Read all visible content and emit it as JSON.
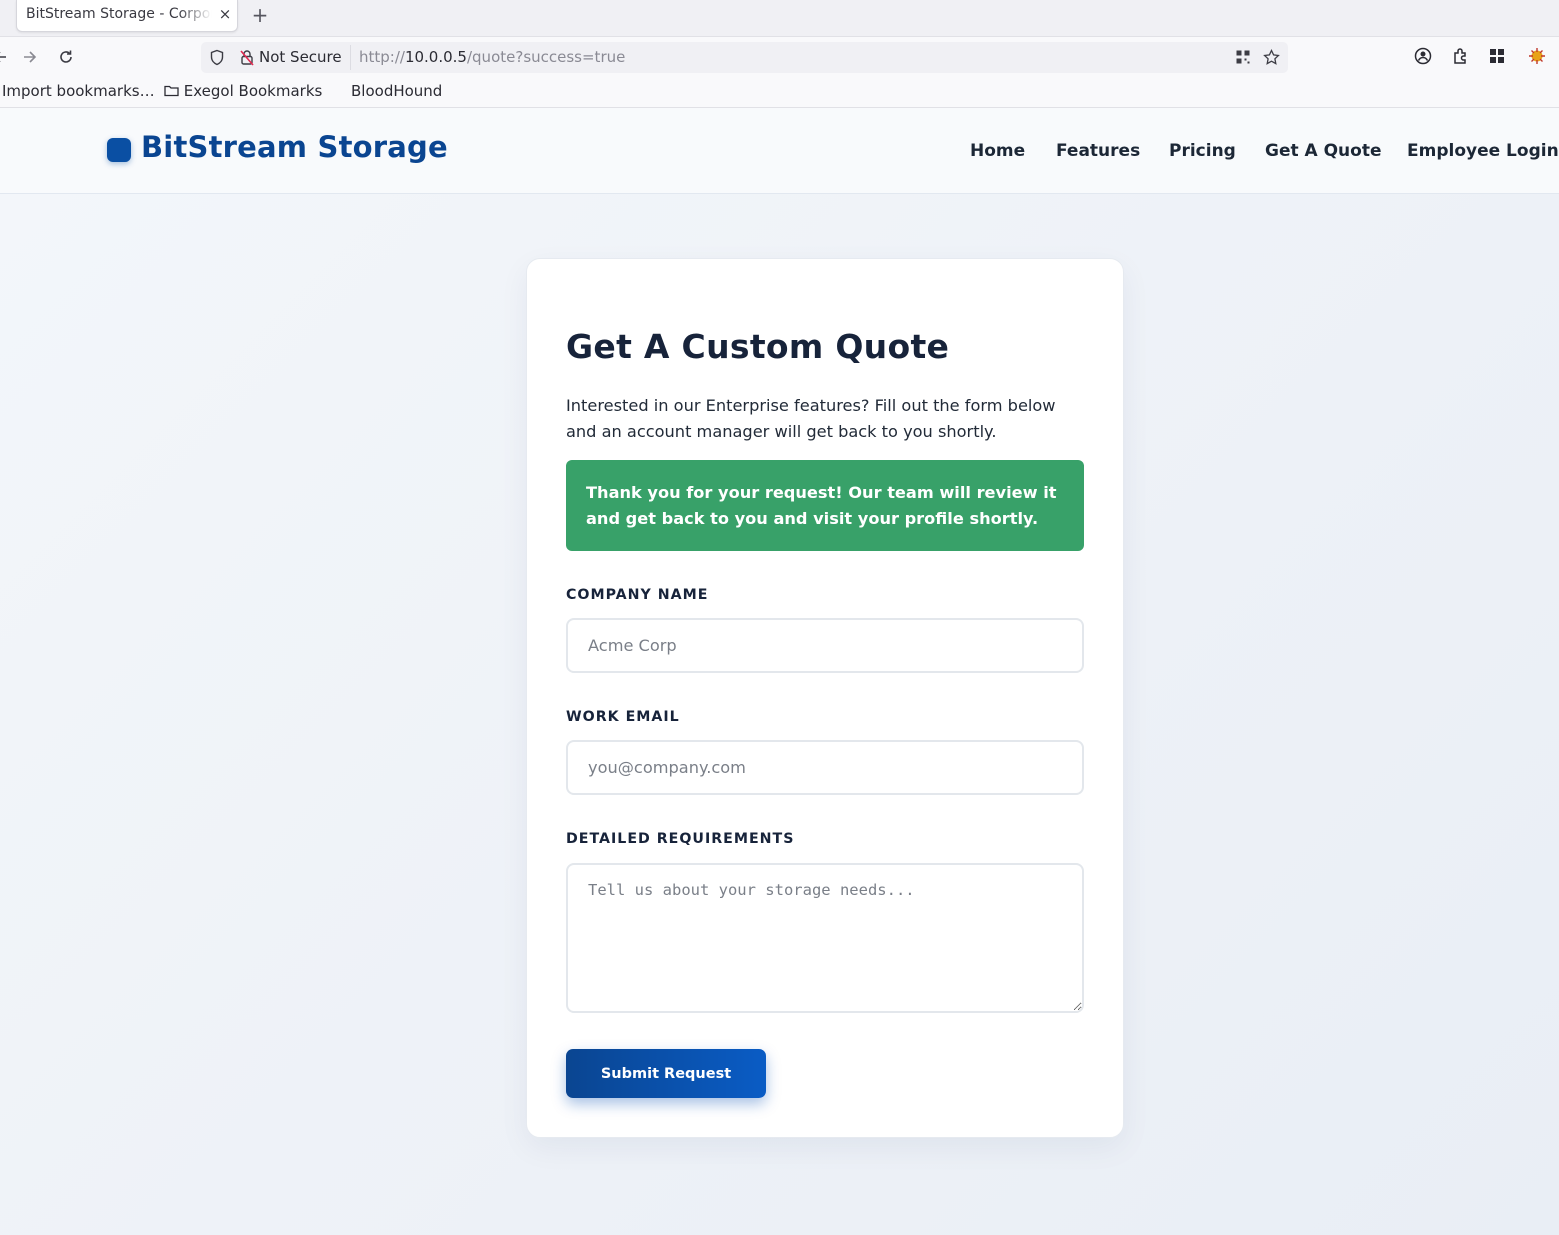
{
  "browser": {
    "tab_title": "BitStream Storage - Corporate",
    "tab_close": "×",
    "new_tab": "+",
    "not_secure": "Not Secure",
    "url_scheme": "http://",
    "url_host": "10.0.0.5",
    "url_path": "/quote?success=true",
    "bookmarks": [
      "Import bookmarks…",
      "Exegol Bookmarks",
      "BloodHound"
    ]
  },
  "site": {
    "brand": "BitStream Storage",
    "brand_color": "#0a4591",
    "nav": [
      "Home",
      "Features",
      "Pricing",
      "Get A Quote",
      "Employee Login"
    ]
  },
  "form": {
    "title": "Get A Custom Quote",
    "description": "Interested in our Enterprise features? Fill out the form below and an account manager will get back to you shortly.",
    "success_message": "Thank you for your request! Our team will review it and get back to you and visit your profile shortly.",
    "success_color": "#38a169",
    "company_label": "COMPANY NAME",
    "company_placeholder": "Acme Corp",
    "company_value": "",
    "email_label": "WORK EMAIL",
    "email_placeholder": "you@company.com",
    "email_value": "",
    "requirements_label": "DETAILED REQUIREMENTS",
    "requirements_placeholder": "Tell us about your storage needs...",
    "requirements_value": "",
    "submit_label": "Submit Request"
  }
}
